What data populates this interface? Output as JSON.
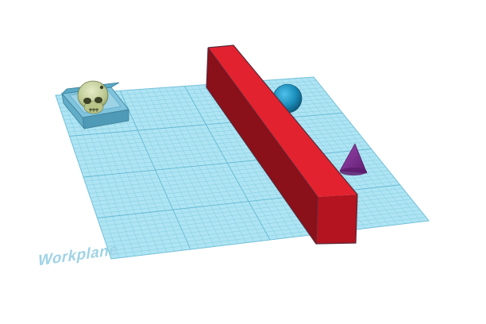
{
  "workplane": {
    "label": "Workplane",
    "fill": "#aee4f3",
    "grid_color": "#7ec9df",
    "major_grid_color": "#64b8d2",
    "label_color": "#9fd3e6"
  },
  "shapes": {
    "box_bar": {
      "shape": "box",
      "color": "#e3222f",
      "side_color": "#8a1019",
      "front_color": "#b3141f"
    },
    "sphere": {
      "shape": "sphere",
      "color": "#1b8fbd"
    },
    "cone": {
      "shape": "cone",
      "color": "#7b2a8e"
    },
    "skull_in_tray": {
      "shape": "imported-model",
      "skull_color": "#c9d3a0",
      "tray_color": "#7fc3dc"
    }
  },
  "icons": {
    "workplane": "grid-plane",
    "bar": "box-shape",
    "sphere": "sphere-shape",
    "cone": "cone-shape",
    "skull": "skull-model"
  }
}
